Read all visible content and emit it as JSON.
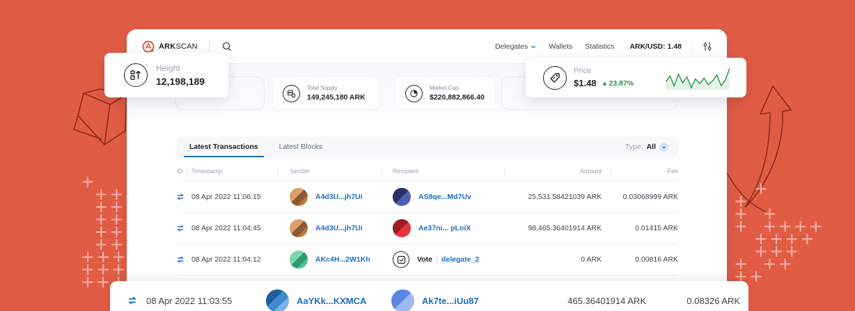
{
  "brand": {
    "name_bold": "ARK",
    "name_light": "SCAN"
  },
  "nav": {
    "delegates": "Delegates",
    "wallets": "Wallets",
    "statistics": "Statistics",
    "price_indicator": "ARK/USD: 1.48"
  },
  "stats": {
    "total_supply": {
      "label": "Total Supply",
      "value": "149,245,180 ARK"
    },
    "market_cap": {
      "label": "Market Cap",
      "value": "$220,882,866.40"
    }
  },
  "height_card": {
    "label": "Height",
    "value": "12,198,189"
  },
  "price_card": {
    "label": "Price",
    "value": "$1.48",
    "change": "23.87%",
    "change_direction": "up",
    "sparkline": [
      12,
      18,
      8,
      20,
      11,
      17,
      6,
      15,
      10,
      16,
      9,
      13,
      19,
      8,
      14,
      26
    ]
  },
  "tabs": [
    {
      "label": "Latest Transactions",
      "active": true
    },
    {
      "label": "Latest Blocks",
      "active": false
    }
  ],
  "type_filter": {
    "label": "Type:",
    "value": "All"
  },
  "table": {
    "headers": {
      "id": "ID",
      "timestamp": "Timestamp",
      "sender": "Sender",
      "recipient": "Recipient",
      "amount": "Amount",
      "fee": "Fee"
    },
    "rows": [
      {
        "timestamp": "08 Apr 2022 11:06:15",
        "sender": "A4d3U...jh7Ui",
        "recipient": "AS8qe...Md7Uv",
        "amount": "25,531.58421039 ARK",
        "fee": "0.03068999 ARK"
      },
      {
        "timestamp": "08 Apr 2022 11:04:45",
        "sender": "A4d3U...jh7Ui",
        "recipient": "Ae37ni... pLoiX",
        "amount": "98,465.36401914 ARK",
        "fee": "0.01415 ARK"
      },
      {
        "timestamp": "08 Apr 2022 11:04:12",
        "sender": "AKc4H...2W1Kh",
        "vote_label": "Vote",
        "recipient": "delegate_2",
        "amount": "0 ARK",
        "fee": "0.00816 ARK"
      }
    ],
    "highlight_row": {
      "timestamp": "08 Apr 2022 11:03:55",
      "sender": "AaYKk...KXMCA",
      "recipient": "Ak7te...iUu87",
      "amount": "465.36401914 ARK",
      "fee": "0.08326 ARK"
    }
  },
  "colors": {
    "background": "#e15c45",
    "link": "#1c6ec1",
    "positive": "#289548"
  }
}
